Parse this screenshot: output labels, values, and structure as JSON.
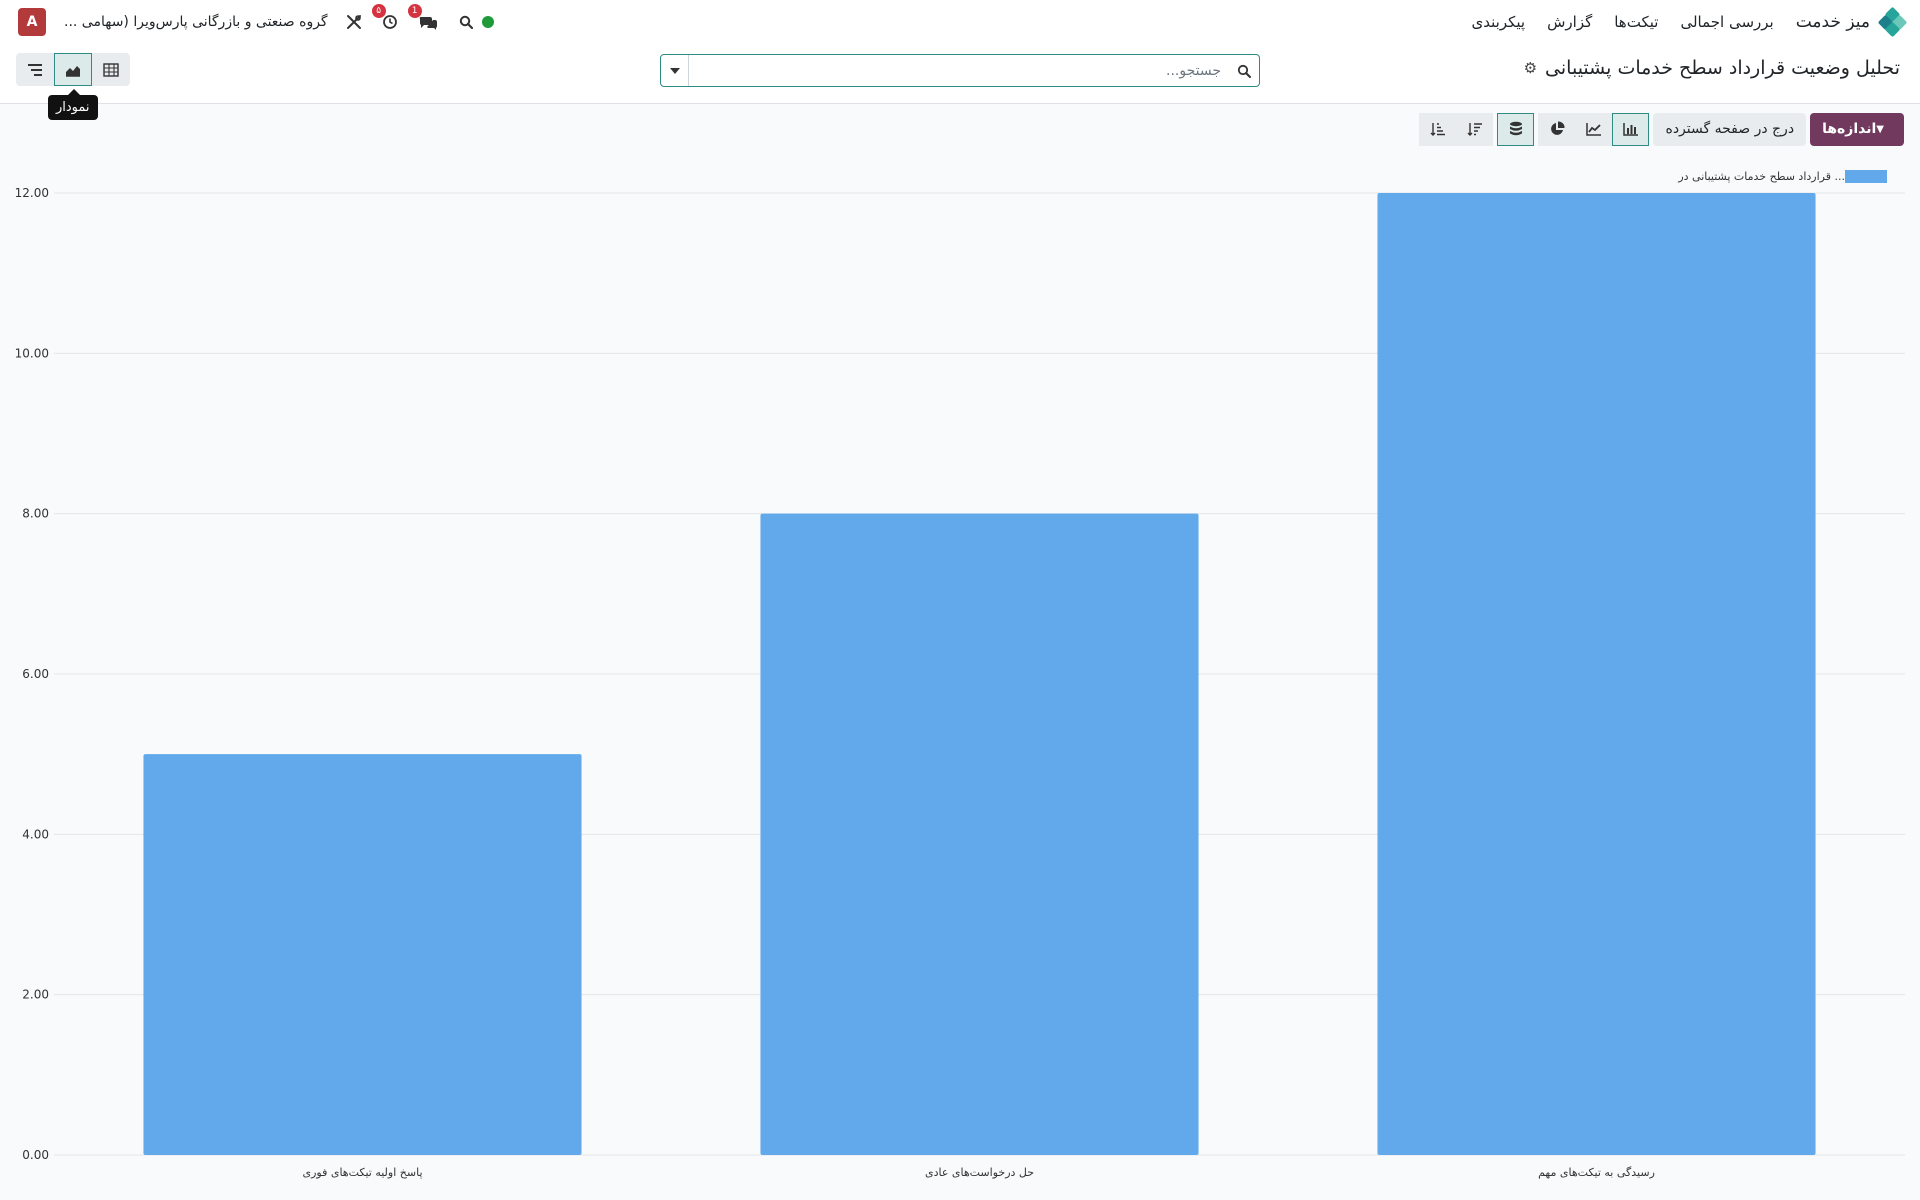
{
  "navbar": {
    "app_name": "میز خدمت",
    "menu": [
      "بررسی اجمالی",
      "تیکت‌ها",
      "گزارش",
      "پیکربندی"
    ],
    "company": "گروه صنعتی و بازرگانی پارس‌ویرا (سهامی ...",
    "user_initial": "A",
    "activity_count": "۵",
    "messages_count": "1",
    "status_color": "#1f9a3a"
  },
  "control": {
    "title": "تحلیل وضعیت قرارداد سطح خدمات پشتیبانی",
    "search_placeholder": "جستجو...",
    "tooltip": "نمودار",
    "views": [
      "pivot-icon",
      "graph-icon",
      "list-icon"
    ],
    "active_view": "graph"
  },
  "toolbar": {
    "measures_label": "اندازه‌ها",
    "spread_label": "درج در صفحه گسترده",
    "chart_types": [
      "bar-chart-icon",
      "line-chart-icon",
      "pie-chart-icon"
    ],
    "active_chart_type": "bar",
    "stacked_active": true,
    "sort_buttons": [
      "sort-descending-icon",
      "sort-ascending-icon"
    ]
  },
  "colors": {
    "brand": "#71395e",
    "accent": "#2e8b86",
    "bar": "#61a9ea"
  },
  "chart_data": {
    "type": "bar",
    "categories": [
      "پاسخ اولیه تیکت‌های فوری",
      "حل درخواست‌های عادی",
      "رسیدگی به تیکت‌های مهم"
    ],
    "series": [
      {
        "name": "قرارداد سطح خدمات پشتیبانی در ...",
        "values": [
          5,
          8,
          12
        ]
      }
    ],
    "ylim": [
      0,
      12
    ],
    "yticks": [
      "0.00",
      "2.00",
      "4.00",
      "6.00",
      "8.00",
      "10.00",
      "12.00"
    ],
    "grid": true,
    "legend": "top-right"
  }
}
